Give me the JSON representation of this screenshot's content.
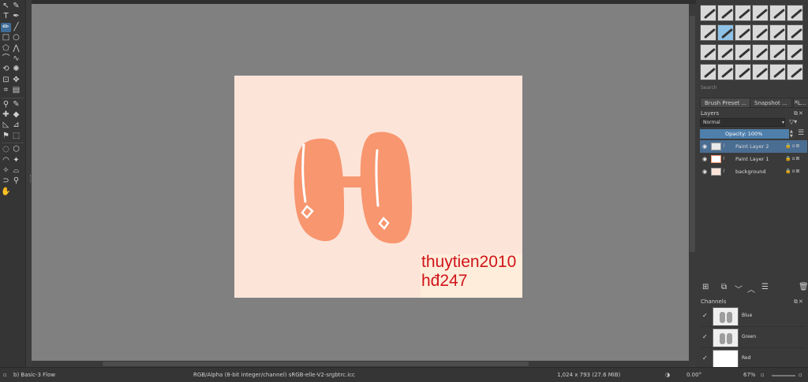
{
  "toolbox": {
    "tools": [
      {
        "name": "select-shapes-icon",
        "glyph": "↖"
      },
      {
        "name": "edit-shapes-icon",
        "glyph": "✎"
      },
      {
        "name": "text-icon",
        "glyph": "T"
      },
      {
        "name": "calligraphy-icon",
        "glyph": "✒"
      },
      {
        "name": "freehand-brush-icon",
        "glyph": "✏",
        "active": true
      },
      {
        "name": "line-icon",
        "glyph": "╱"
      },
      {
        "name": "rectangle-icon",
        "glyph": "□"
      },
      {
        "name": "ellipse-icon",
        "glyph": "○"
      },
      {
        "name": "polygon-icon",
        "glyph": "⬠"
      },
      {
        "name": "polyline-icon",
        "glyph": "⋀"
      },
      {
        "name": "bezier-icon",
        "glyph": "⌒"
      },
      {
        "name": "freehand-path-icon",
        "glyph": "∿"
      },
      {
        "name": "dynamic-brush-icon",
        "glyph": "⟲"
      },
      {
        "name": "multibrush-icon",
        "glyph": "✺"
      },
      {
        "name": "transform-icon",
        "glyph": "⊡"
      },
      {
        "name": "move-icon",
        "glyph": "✥"
      },
      {
        "name": "crop-icon",
        "glyph": "⌗"
      },
      {
        "name": "gradient-icon",
        "glyph": "▤"
      },
      {
        "name": "color-picker-icon",
        "glyph": "⚲"
      },
      {
        "name": "colorize-mask-icon",
        "glyph": "✎"
      },
      {
        "name": "smart-patch-icon",
        "glyph": "✚"
      },
      {
        "name": "fill-icon",
        "glyph": "◆"
      },
      {
        "name": "measure-icon",
        "glyph": "◺"
      },
      {
        "name": "assistant-icon",
        "glyph": "⊿"
      },
      {
        "name": "reference-images-icon",
        "glyph": "⚑"
      },
      {
        "name": "rect-select-icon",
        "glyph": "⬚"
      },
      {
        "name": "ellipse-select-icon",
        "glyph": "◌"
      },
      {
        "name": "polygon-select-icon",
        "glyph": "⬡"
      },
      {
        "name": "freehand-select-icon",
        "glyph": "◠"
      },
      {
        "name": "contiguous-select-icon",
        "glyph": "✦"
      },
      {
        "name": "similar-select-icon",
        "glyph": "✧"
      },
      {
        "name": "bezier-select-icon",
        "glyph": "⌓"
      },
      {
        "name": "magnetic-select-icon",
        "glyph": "⊃"
      },
      {
        "name": "zoom-icon",
        "glyph": "⚲"
      },
      {
        "name": "pan-icon",
        "glyph": "✋"
      }
    ]
  },
  "document": {
    "signature_line1": "thuytien2010",
    "signature_line2": "hđ247",
    "background_color": "#fde4d9",
    "shape_color": "#f7966f",
    "accent_color": "#d1131a"
  },
  "docker": {
    "search_label": "Search",
    "tabs": [
      "Brush Preset ...",
      "Snapshot ...",
      "L..."
    ],
    "layers_title": "Layers",
    "blend_mode": "Normal",
    "opacity_label": "Opacity:  100%",
    "layers": [
      {
        "name": "Paint Layer 2",
        "selected": true
      },
      {
        "name": "Paint Layer 1",
        "selected": false
      },
      {
        "name": "background",
        "selected": false
      }
    ],
    "channels_title": "Channels",
    "channels": [
      {
        "name": "Blue",
        "checked": "✓"
      },
      {
        "name": "Green",
        "checked": "✓"
      },
      {
        "name": "Red",
        "checked": "✓"
      }
    ]
  },
  "statusbar": {
    "brush": "b) Basic-3 Flow",
    "color_space": "RGB/Alpha (8-bit integer/channel)  sRGB-elle-V2-srgbtrc.icc",
    "dimensions": "1,024 x 793 (27.6 MiB)",
    "rotation": "0.00°",
    "zoom": "67%"
  }
}
